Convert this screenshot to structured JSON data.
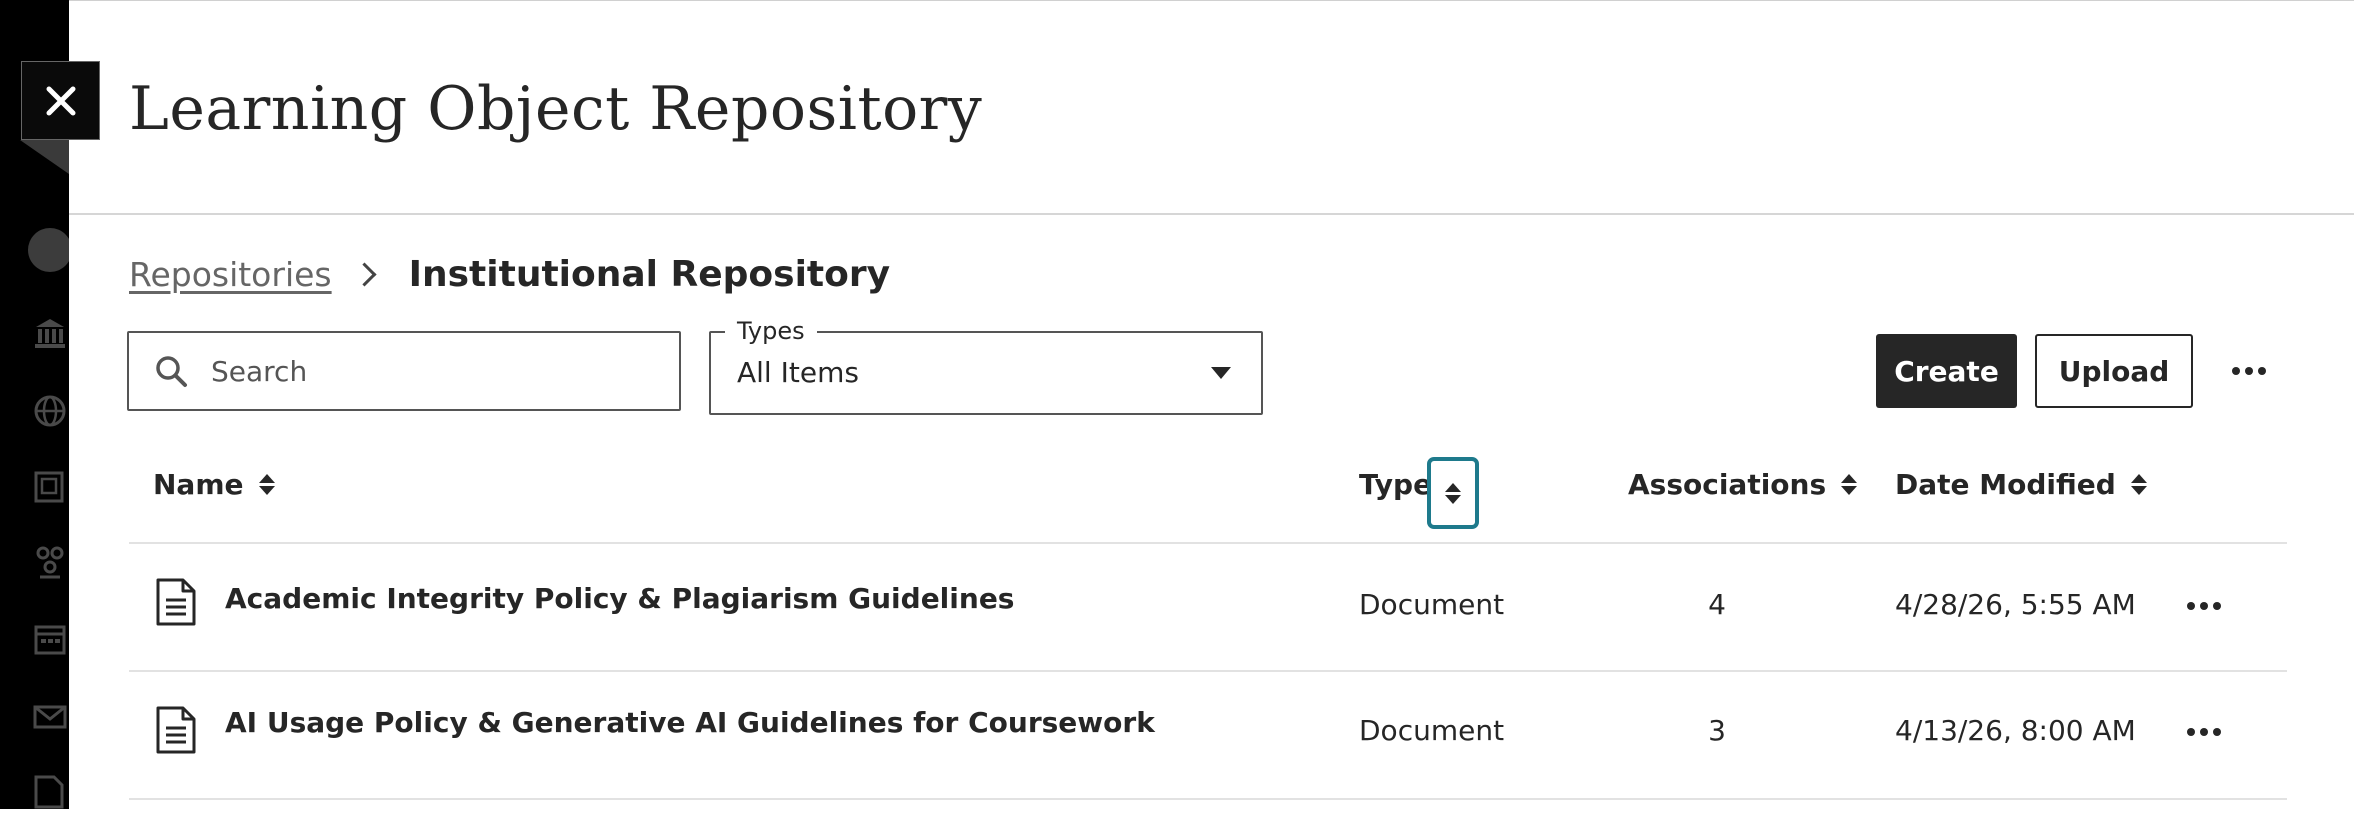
{
  "header": {
    "title": "Learning Object Repository",
    "close_label": "Close"
  },
  "breadcrumb": {
    "parent": "Repositories",
    "current": "Institutional Repository"
  },
  "search": {
    "placeholder": "Search",
    "value": ""
  },
  "types_filter": {
    "legend": "Types",
    "selected": "All Items"
  },
  "toolbar": {
    "create_label": "Create",
    "upload_label": "Upload"
  },
  "table": {
    "columns": [
      {
        "label": "Name",
        "sortable": true
      },
      {
        "label": "Type",
        "sortable": true,
        "focused": true
      },
      {
        "label": "Associations",
        "sortable": true
      },
      {
        "label": "Date Modified",
        "sortable": true
      }
    ],
    "rows": [
      {
        "icon": "document-icon",
        "name": "Academic Integrity Policy & Plagiarism Guidelines",
        "type": "Document",
        "associations": "4",
        "date_modified": "4/28/26, 5:55 AM"
      },
      {
        "icon": "document-icon",
        "name": "AI Usage Policy & Generative AI Guidelines for Coursework",
        "type": "Document",
        "associations": "3",
        "date_modified": "4/13/26, 8:00 AM"
      }
    ]
  },
  "sidebar": {
    "icons": [
      "avatar",
      "institution-icon",
      "globe-icon",
      "courses-icon",
      "organizations-icon",
      "calendar-icon",
      "messages-icon",
      "grades-icon"
    ]
  },
  "colors": {
    "primary_button": "#262626",
    "focus_ring": "#1e7a8c",
    "left_rail": "#000000"
  }
}
